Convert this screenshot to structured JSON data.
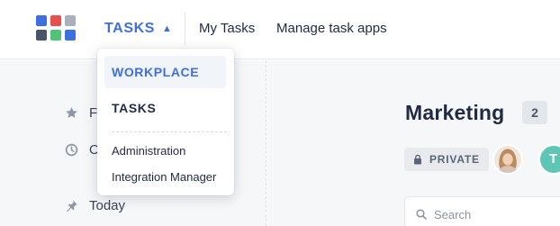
{
  "app_switcher": {
    "label": "TASKS",
    "caret": "▲",
    "icon": "app-grid-icon",
    "tile_colors": [
      "#3d6fe0",
      "#e8504f",
      "#a9b0bb",
      "#4a5568",
      "#52c279",
      "#3d6fe0"
    ]
  },
  "nav": {
    "my_tasks": "My Tasks",
    "manage_task_apps": "Manage task apps"
  },
  "dropdown": {
    "apps": [
      {
        "label": "WORKPLACE",
        "active": true
      },
      {
        "label": "TASKS",
        "active": false
      }
    ],
    "links": [
      {
        "label": "Administration"
      },
      {
        "label": "Integration Manager"
      }
    ]
  },
  "sidebar": {
    "items": [
      {
        "label": "Fo",
        "icon": "star-icon"
      },
      {
        "label": "O",
        "icon": "clock-icon"
      },
      {
        "label": "Today",
        "icon": "pin-icon"
      }
    ]
  },
  "board": {
    "title": "Marketing",
    "count": "2",
    "privacy": "PRIVATE",
    "privacy_icon": "lock-icon",
    "members": [
      {
        "type": "photo",
        "icon": "avatar-photo"
      },
      {
        "type": "initial",
        "initial": "T",
        "color": "#5fc6b5"
      }
    ],
    "search_placeholder": "Search"
  },
  "colors": {
    "accent": "#3d6fe0",
    "text": "#1f2a44",
    "background": "#f6f7f9"
  }
}
